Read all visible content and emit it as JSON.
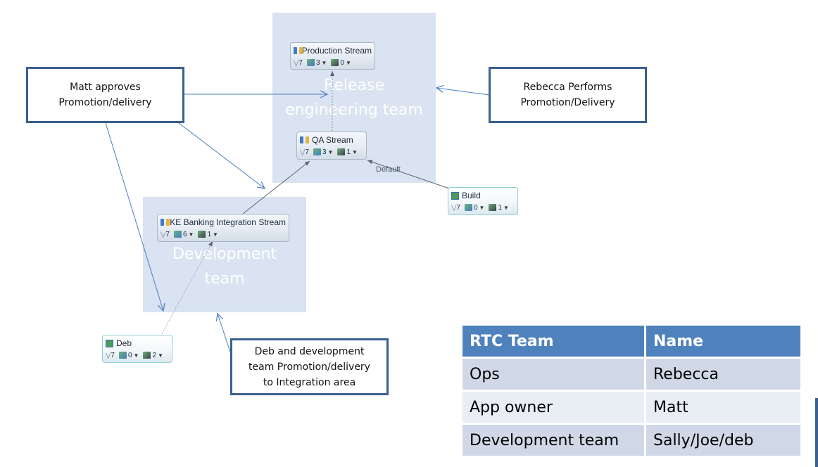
{
  "team_areas": {
    "release": {
      "label": "Release\nengineering team"
    },
    "development": {
      "label": "Development\nteam"
    }
  },
  "streams": [
    {
      "id": "production",
      "kind": "stream",
      "name": "Production Stream",
      "history": "7",
      "incoming": "3",
      "outgoing": "0"
    },
    {
      "id": "qa",
      "kind": "stream",
      "name": "QA Stream",
      "history": "7",
      "incoming": "3",
      "outgoing": "1"
    },
    {
      "id": "integration",
      "kind": "stream",
      "name": "JKE Banking Integration Stream",
      "history": "7",
      "incoming": "6",
      "outgoing": "1"
    },
    {
      "id": "build",
      "kind": "workspace",
      "name": "Build",
      "history": "7",
      "incoming": "0",
      "outgoing": "1"
    },
    {
      "id": "deb",
      "kind": "workspace",
      "name": "Deb",
      "history": "7",
      "incoming": "0",
      "outgoing": "2"
    }
  ],
  "flow_labels": {
    "build_to_qa": "Default"
  },
  "callouts": {
    "matt": "Matt approves\nPromotion/delivery",
    "rebecca": "Rebecca Performs\nPromotion/Delivery",
    "deb": "Deb and development\nteam Promotion/delivery\nto Integration area"
  },
  "roles_table": {
    "headers": [
      "RTC Team",
      "Name"
    ],
    "rows": [
      [
        "Ops",
        "Rebecca"
      ],
      [
        "App owner",
        "Matt"
      ],
      [
        "Development team",
        "Sally/Joe/deb"
      ]
    ]
  },
  "colors": {
    "team_area": "#d9e3f1",
    "callout_border": "#3a5f91",
    "arrow_blue": "#4a7ec2",
    "flow_gray": "#5a6470",
    "table_header": "#4f81bd",
    "table_row_odd": "#d0d8e8",
    "table_row_even": "#e9edf4"
  }
}
